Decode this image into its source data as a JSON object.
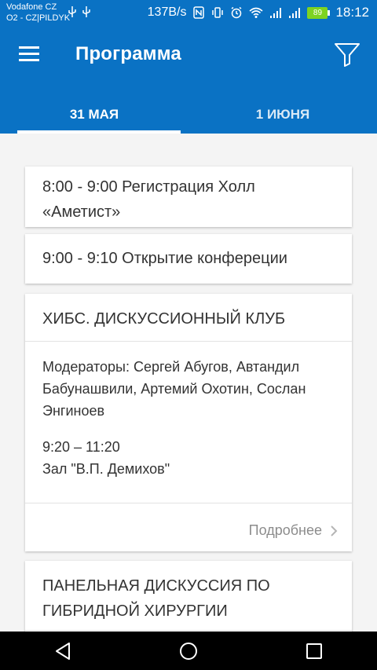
{
  "status_bar": {
    "carrier_line1": "Vodafone CZ",
    "carrier_line2": "O2 - CZ|PILDYK",
    "usb_icons": "⚲ ⚲",
    "net_speed": "137B/s",
    "battery": "89",
    "time": "18:12"
  },
  "app_bar": {
    "title": "Программа"
  },
  "tabs": [
    {
      "label": "31 МАЯ",
      "active": true
    },
    {
      "label": "1 ИЮНЯ",
      "active": false
    }
  ],
  "program": {
    "item1": "8:00 - 9:00 Регистрация Холл «Аметист»",
    "item2": "9:00 - 9:10 Открытие конфереции",
    "session1": {
      "title": "ХИБС. ДИСКУССИОННЫЙ КЛУБ",
      "moderators": "Модераторы: Сергей Абугов, Автандил Бабунашвили, Артемий Охотин, Сослан Энгиноев",
      "time": "9:20 – 11:20",
      "hall": "Зал \"В.П. Демихов\"",
      "details_label": "Подробнее"
    },
    "session2": {
      "title": "ПАНЕЛЬНАЯ ДИСКУССИЯ ПО ГИБРИДНОЙ ХИРУРГИИ"
    }
  },
  "colors": {
    "primary": "#0a72c4",
    "battery": "#7ed321"
  }
}
